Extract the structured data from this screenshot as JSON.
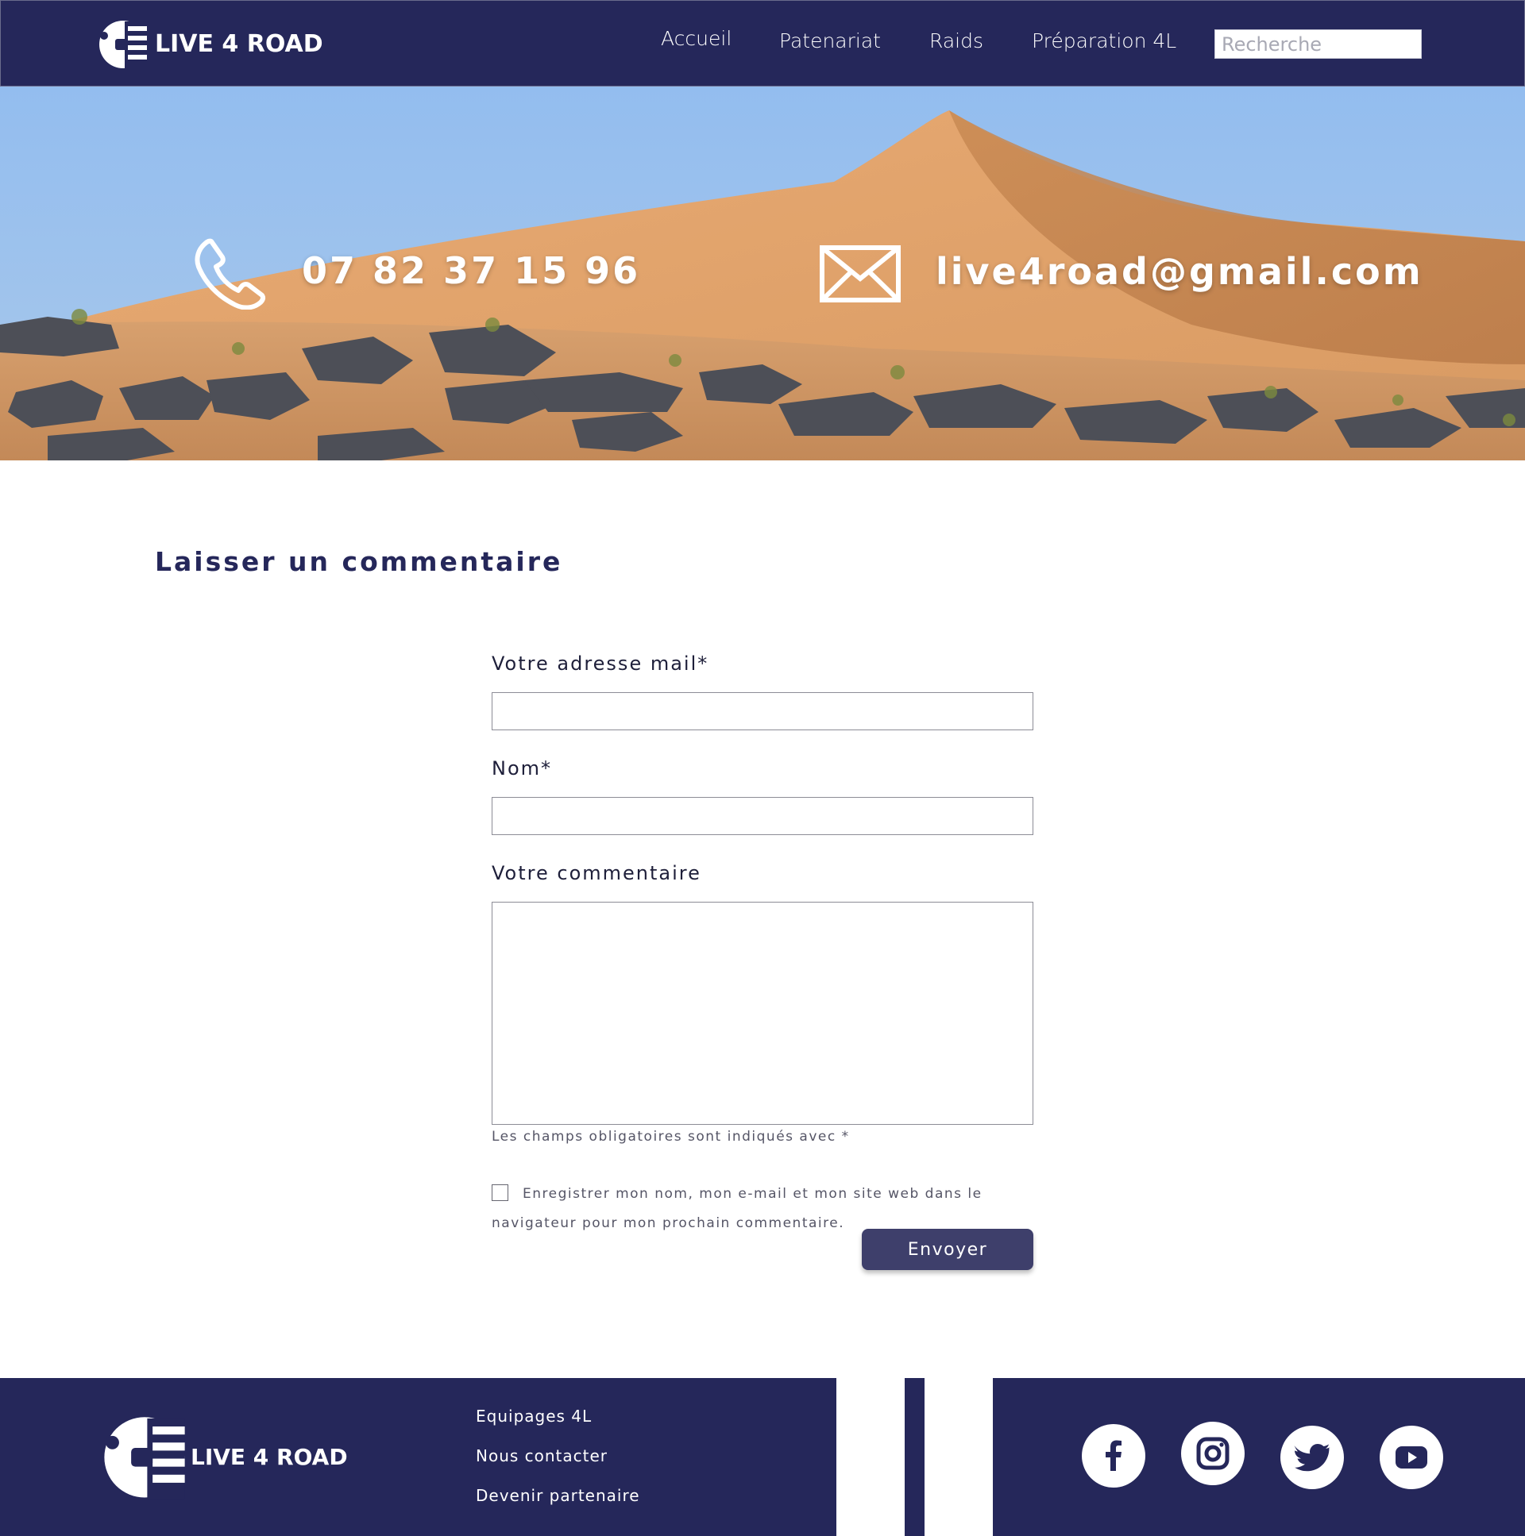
{
  "header": {
    "brand": "LIVE 4 ROAD",
    "nav": [
      {
        "label": "Accueil"
      },
      {
        "label": "Patenariat"
      },
      {
        "label": "Raids"
      },
      {
        "label": "Préparation 4L"
      }
    ],
    "search": {
      "placeholder": "Recherche"
    }
  },
  "hero": {
    "phone": "07 82 37 15 96",
    "email": "live4road@gmail.com"
  },
  "comment_form": {
    "title": "Laisser un commentaire",
    "email_label": "Votre adresse mail*",
    "email_value": "",
    "name_label": "Nom*",
    "name_value": "",
    "comment_label": "Votre commentaire",
    "comment_value": "",
    "required_hint": "Les champs obligatoires sont indiqués avec *",
    "consent_label": "Enregistrer mon nom, mon e-mail et mon site web dans le navigateur pour mon prochain commentaire.",
    "consent_checked": false,
    "submit_label": "Envoyer"
  },
  "footer": {
    "brand": "LIVE 4 ROAD",
    "links": [
      {
        "label": "Equipages 4L"
      },
      {
        "label": "Nous contacter"
      },
      {
        "label": "Devenir partenaire"
      }
    ],
    "social": [
      {
        "icon": "facebook-icon"
      },
      {
        "icon": "instagram-icon"
      },
      {
        "icon": "twitter-icon"
      },
      {
        "icon": "youtube-icon"
      }
    ]
  },
  "colors": {
    "navy": "#25275a",
    "button": "#3e3f6b",
    "sky": "#93bdef",
    "sand": "#d39a62"
  }
}
